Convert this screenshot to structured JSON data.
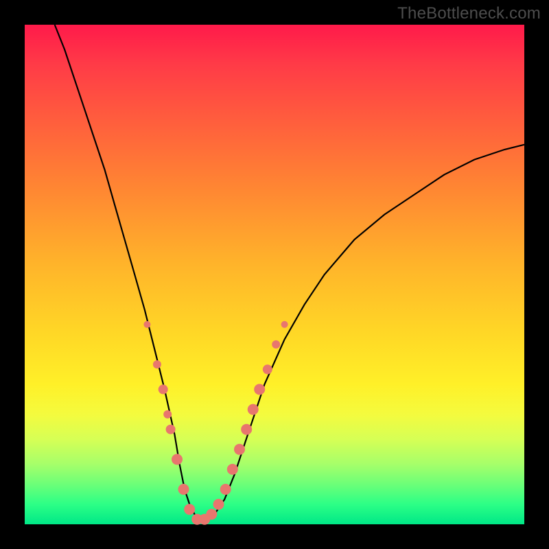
{
  "watermark": "TheBottleneck.com",
  "chart_data": {
    "type": "line",
    "title": "",
    "xlabel": "",
    "ylabel": "",
    "xlim": [
      0,
      100
    ],
    "ylim": [
      0,
      100
    ],
    "series": [
      {
        "name": "bottleneck-curve",
        "x": [
          6,
          8,
          10,
          12,
          14,
          16,
          18,
          20,
          22,
          24,
          26,
          28,
          30,
          31,
          32,
          33,
          34,
          35,
          36,
          38,
          40,
          42,
          44,
          46,
          48,
          52,
          56,
          60,
          66,
          72,
          78,
          84,
          90,
          96,
          100
        ],
        "values": [
          100,
          95,
          89,
          83,
          77,
          71,
          64,
          57,
          50,
          43,
          35,
          27,
          18,
          12,
          7,
          4,
          2,
          1,
          1,
          2,
          5,
          10,
          16,
          22,
          28,
          37,
          44,
          50,
          57,
          62,
          66,
          70,
          73,
          75,
          76
        ]
      }
    ],
    "markers": {
      "name": "highlighted-points",
      "points": [
        {
          "x": 24.5,
          "y": 40,
          "r": 5
        },
        {
          "x": 26.5,
          "y": 32,
          "r": 6
        },
        {
          "x": 27.7,
          "y": 27,
          "r": 7
        },
        {
          "x": 28.6,
          "y": 22,
          "r": 6
        },
        {
          "x": 29.2,
          "y": 19,
          "r": 7
        },
        {
          "x": 30.5,
          "y": 13,
          "r": 8
        },
        {
          "x": 31.8,
          "y": 7,
          "r": 8
        },
        {
          "x": 33.0,
          "y": 3,
          "r": 8
        },
        {
          "x": 34.5,
          "y": 1,
          "r": 8
        },
        {
          "x": 36.0,
          "y": 1,
          "r": 8
        },
        {
          "x": 37.4,
          "y": 2,
          "r": 8
        },
        {
          "x": 38.8,
          "y": 4,
          "r": 8
        },
        {
          "x": 40.2,
          "y": 7,
          "r": 8
        },
        {
          "x": 41.6,
          "y": 11,
          "r": 8
        },
        {
          "x": 43.0,
          "y": 15,
          "r": 8
        },
        {
          "x": 44.4,
          "y": 19,
          "r": 8
        },
        {
          "x": 45.7,
          "y": 23,
          "r": 8
        },
        {
          "x": 47.0,
          "y": 27,
          "r": 8
        },
        {
          "x": 48.6,
          "y": 31,
          "r": 7
        },
        {
          "x": 50.3,
          "y": 36,
          "r": 6
        },
        {
          "x": 52.0,
          "y": 40,
          "r": 5
        }
      ]
    }
  }
}
